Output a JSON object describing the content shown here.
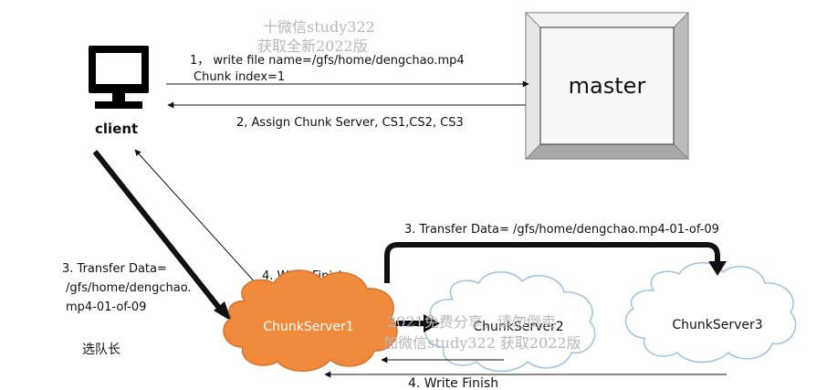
{
  "nodes": {
    "client": "client",
    "master": "master",
    "chunkserver1": "ChunkServer1",
    "chunkserver2": "ChunkServer2",
    "chunkserver3": "ChunkServer3"
  },
  "labels": {
    "step1_line1": "1， write file name=/gfs/home/dengchao.mp4",
    "step1_line2": "Chunk index=1",
    "step2": "2, Assign Chunk Server, CS1,CS2, CS3",
    "step3_client_line1": "3. Transfer Data=",
    "step3_client_line2": "/gfs/home/dengchao.",
    "step3_client_line3": "mp4-01-of-09",
    "step3_chain": "3. Transfer Data= /gfs/home/dengchao.mp4-01-of-09",
    "step4_cs1": "4. Write Finish",
    "step4_chain": "4. Write Finish",
    "leader_note": "选队长"
  },
  "watermarks": {
    "top_line1": "十微信study322",
    "top_line2": "获取全新2022版",
    "mid_line1": "2021免费分享，请勿倒卖",
    "mid_line2": "加微信study322 获取2022版"
  },
  "colors": {
    "chunkserver1_fill": "#f08a3c",
    "chunkserver1_stroke": "#d9722a",
    "cloud_stroke": "#9cc3e6",
    "master_fill": "#f2f2f2",
    "line": "#111111",
    "watermark": "#b8b8b8"
  },
  "icons": {
    "client": "monitor-icon"
  }
}
